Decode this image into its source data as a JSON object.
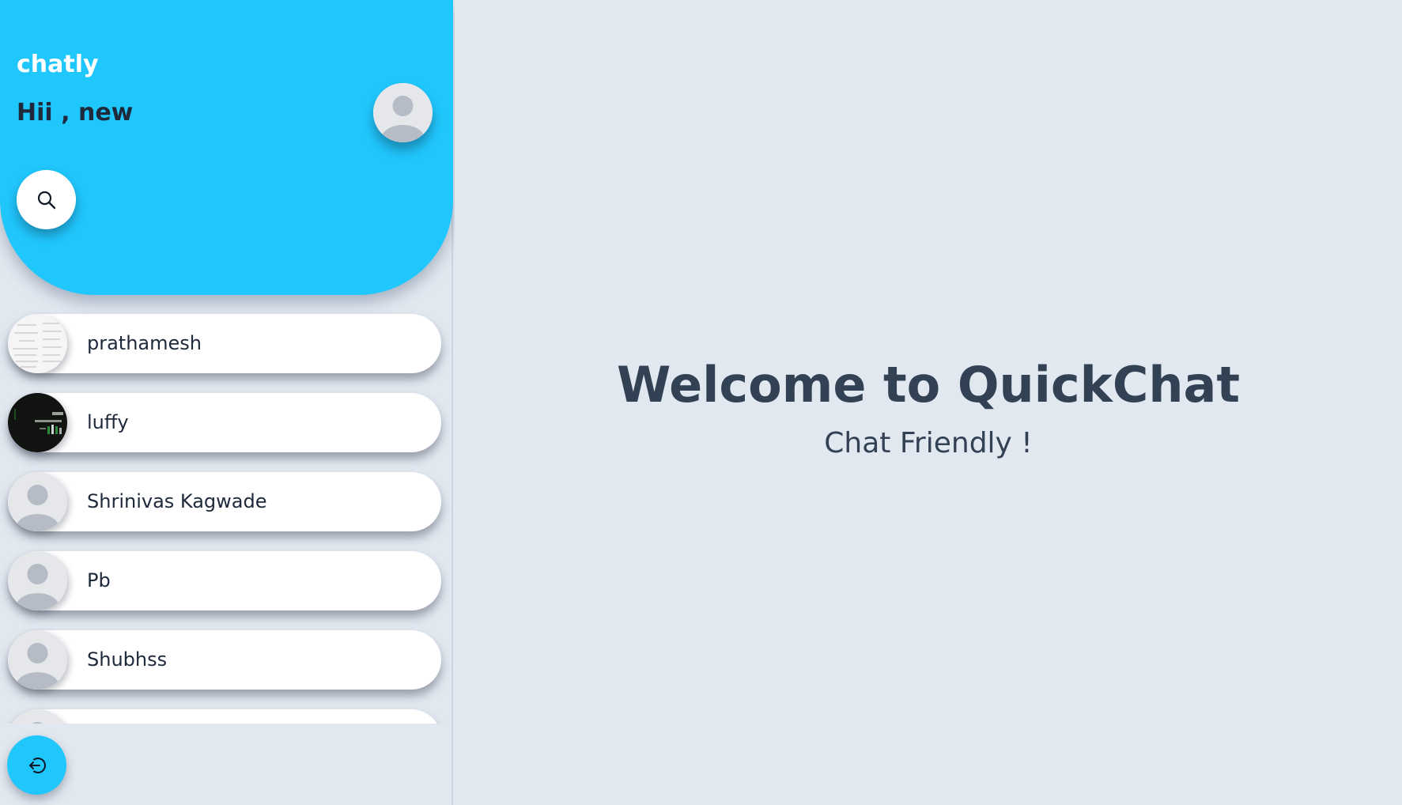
{
  "sidebar": {
    "brand": "chatly",
    "greeting": "Hii , new",
    "accent_color": "#20c7fd",
    "search_icon": "search-icon",
    "logout_icon": "logout-icon",
    "contacts": [
      {
        "name": "prathamesh",
        "avatar": "document-photo"
      },
      {
        "name": "luffy",
        "avatar": "dark-photo"
      },
      {
        "name": "Shrinivas Kagwade",
        "avatar": "default-user-icon"
      },
      {
        "name": "Pb",
        "avatar": "default-user-icon"
      },
      {
        "name": "Shubhss",
        "avatar": "default-user-icon"
      },
      {
        "name": "",
        "avatar": "default-user-icon"
      }
    ]
  },
  "main": {
    "welcome": "Welcome to QuickChat",
    "tagline": "Chat Friendly !"
  }
}
